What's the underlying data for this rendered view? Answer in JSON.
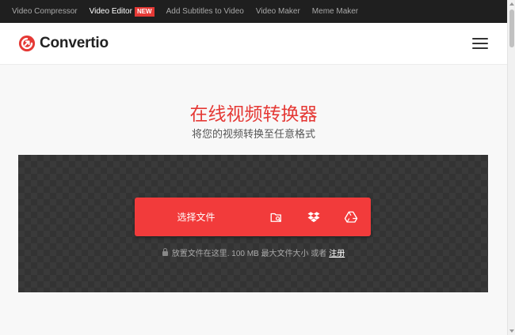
{
  "topnav": {
    "items": [
      {
        "label": "Video Compressor"
      },
      {
        "label": "Video Editor",
        "badge": "NEW"
      },
      {
        "label": "Add Subtitles to Video"
      },
      {
        "label": "Video Maker"
      },
      {
        "label": "Meme Maker"
      }
    ]
  },
  "header": {
    "brand": "Convertio",
    "menu_icon": "hamburger-menu-icon"
  },
  "hero": {
    "title": "在线视频转换器",
    "subtitle": "将您的视频转换至任意格式"
  },
  "upload": {
    "choose_label": "选择文件",
    "sources": [
      "folder-search-icon",
      "dropbox-icon",
      "google-drive-icon"
    ],
    "note_text": "放置文件在这里. 100 MB 最大文件大小 或者",
    "note_link": "注册",
    "note_icon": "lock-icon"
  },
  "colors": {
    "accent": "#f23b3b",
    "title": "#e53935",
    "topbar": "#1f1f1f"
  }
}
